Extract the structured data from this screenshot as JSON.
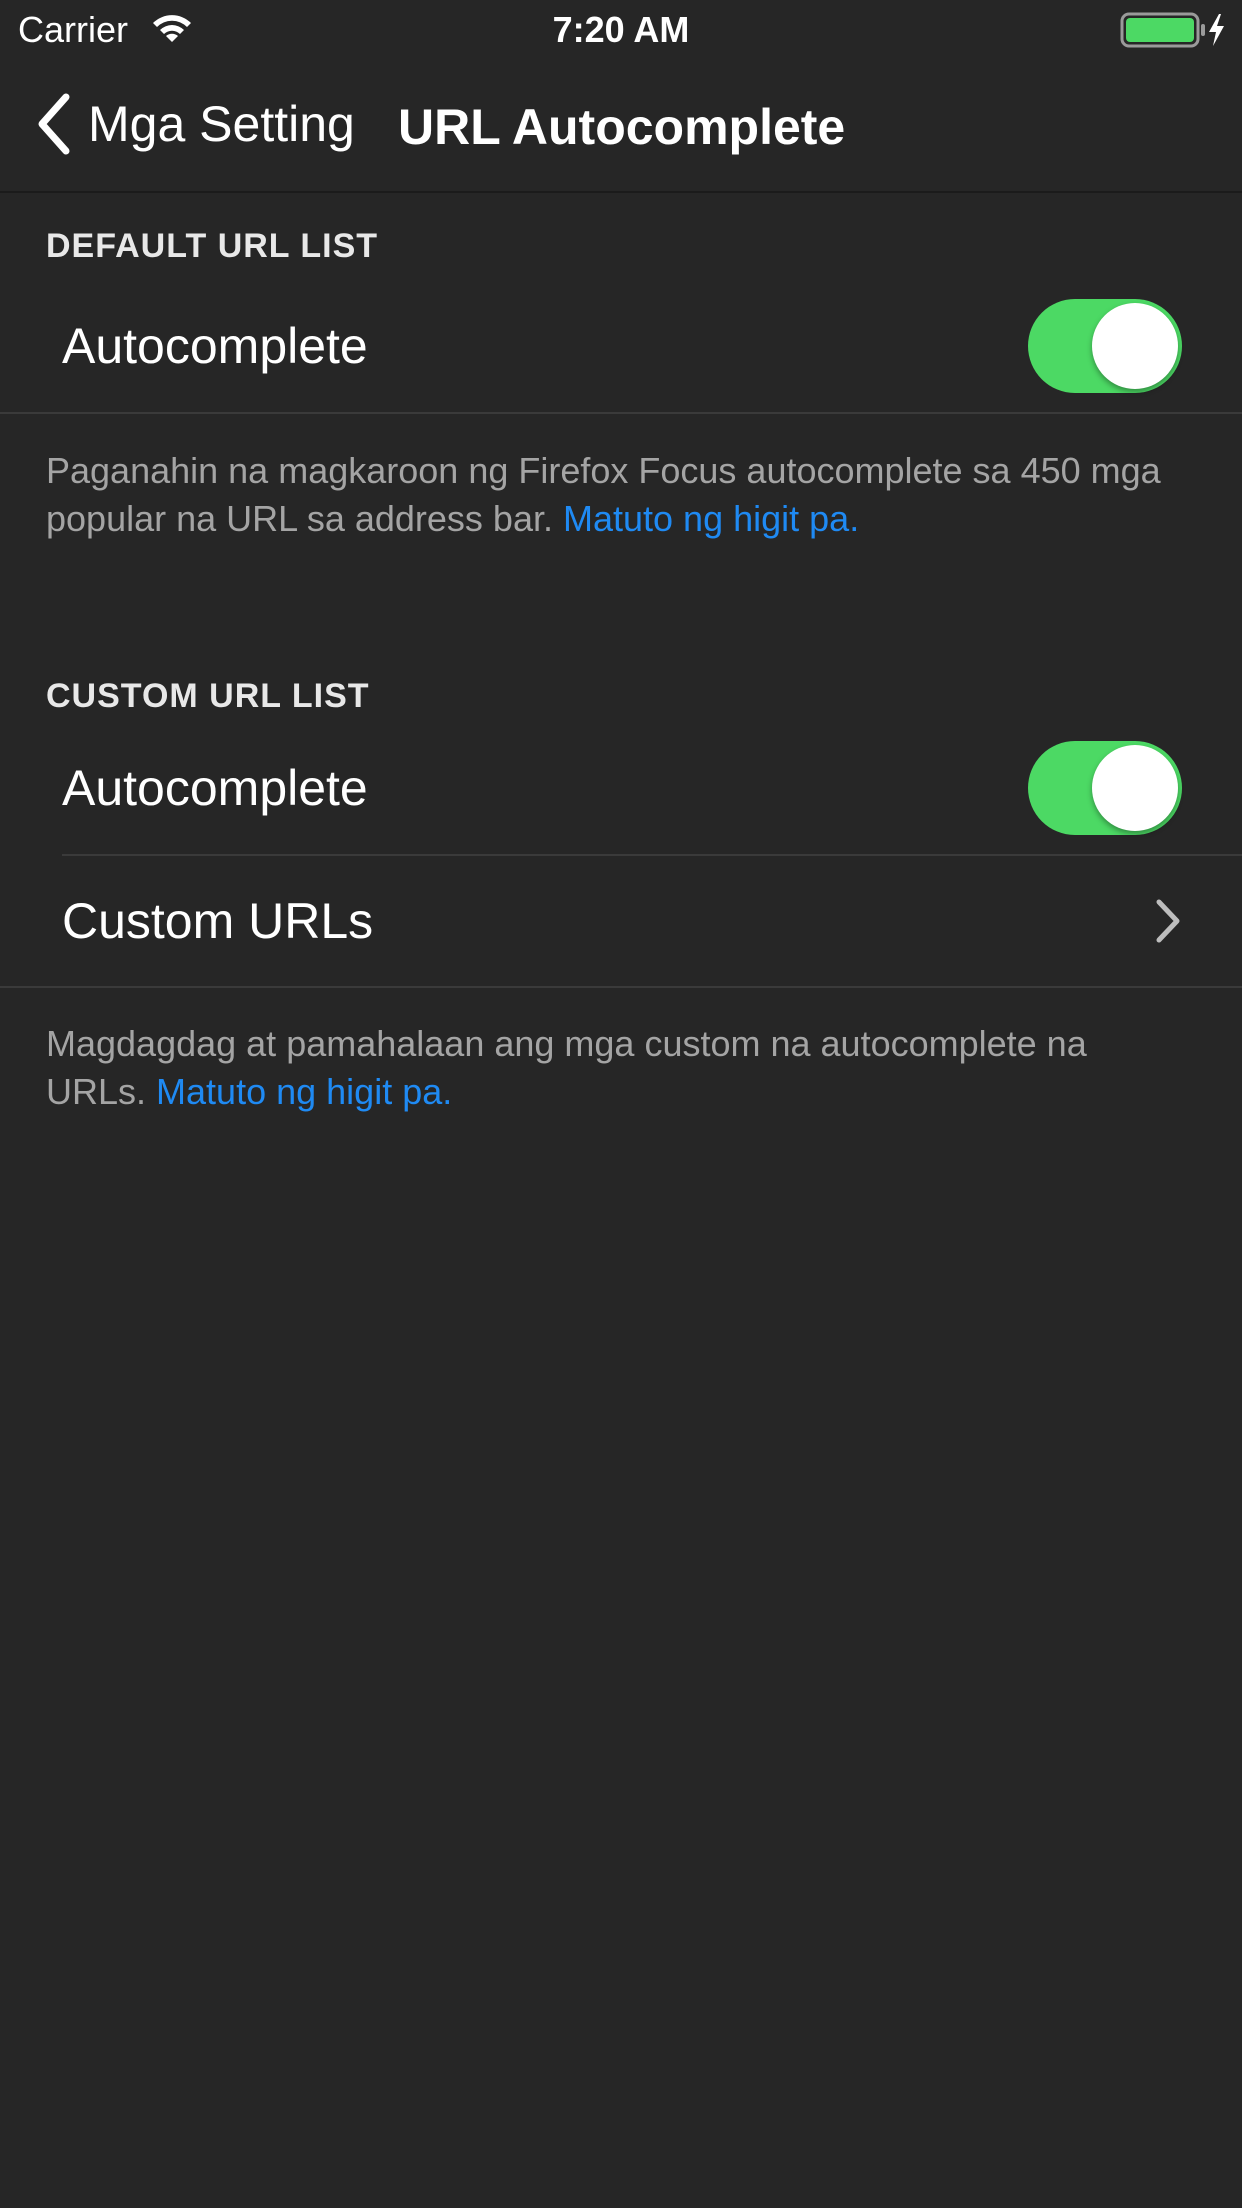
{
  "status_bar": {
    "carrier": "Carrier",
    "time": "7:20 AM",
    "battery_color": "#4cd964",
    "icons": [
      "wifi-icon",
      "battery-icon",
      "charging-bolt-icon"
    ]
  },
  "nav": {
    "back_label": "Mga Setting",
    "title": "URL Autocomplete",
    "back_icon": "chevron-left-icon"
  },
  "sections": {
    "default": {
      "header": "DEFAULT URL LIST",
      "autocomplete_label": "Autocomplete",
      "autocomplete_on": true,
      "footer_text": "Paganahin na magkaroon ng Firefox Focus autocomplete sa 450 mga popular na URL sa address bar.",
      "footer_link": "Matuto ng higit pa."
    },
    "custom": {
      "header": "CUSTOM URL LIST",
      "autocomplete_label": "Autocomplete",
      "autocomplete_on": true,
      "custom_urls_label": "Custom URLs",
      "footer_text": "Magdagdag at pamahalaan ang mga custom na autocomplete na URLs.",
      "footer_link": "Matuto ng higit pa."
    }
  },
  "colors": {
    "background": "#262626",
    "toggle_on": "#4cd964",
    "link": "#1f8af3",
    "footer_text": "#a4a4a4"
  }
}
